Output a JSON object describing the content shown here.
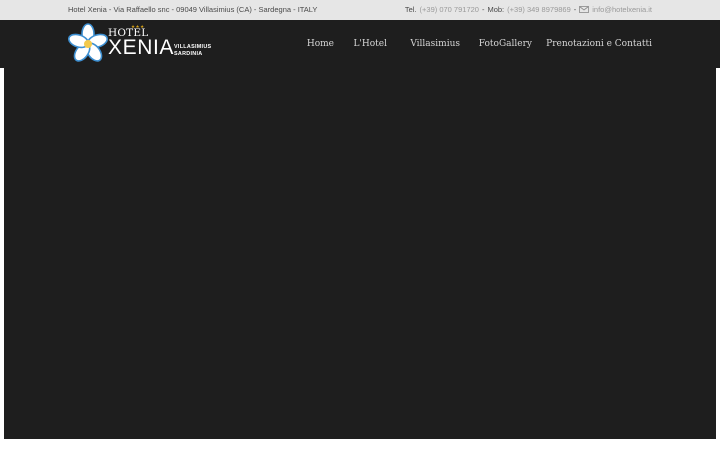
{
  "topbar": {
    "address": "Hotel Xenia - Via Raffaello snc - 09049 Villasimius (CA) - Sardegna - ITALY",
    "tel_label": "Tel.",
    "tel_value": "(+39) 070 791720",
    "sep1": "-",
    "mob_label": "Mob:",
    "mob_value": "(+39) 349 8979869",
    "sep2": "-",
    "mail_icon": "envelope-icon",
    "email": "info@hotelxenia.it"
  },
  "logo": {
    "icon": "frangipani-flower-logo",
    "stars": "★★★",
    "hotel": "HOTEL",
    "name": "XENIA",
    "sub1": "VILLASIMIUS",
    "sub2": "SARDINIA"
  },
  "menu": {
    "home": "Home",
    "hotel": "L'Hotel",
    "villasimius": "Villasimius",
    "gallery": "FotoGallery",
    "contacts": "Prenotazioni e Contatti"
  },
  "colors": {
    "topbar_bg": "#e6e6e6",
    "nav_bg": "#1e1e1e",
    "flower_blue": "#3d8fd1",
    "flower_center": "#f2c94c"
  }
}
